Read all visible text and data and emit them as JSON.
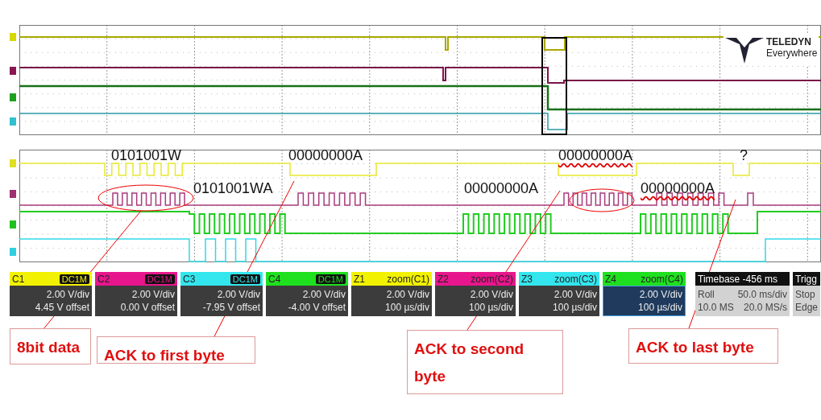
{
  "logo": {
    "brand": "TELEDYN",
    "tagline": "Everywhere"
  },
  "decode_labels": [
    {
      "text": "0101001W",
      "squiggle": false
    },
    {
      "text": "00000000A",
      "squiggle": false
    },
    {
      "text": "00000000A",
      "squiggle": true
    },
    {
      "text": "?",
      "squiggle": false
    },
    {
      "text": "0101001WA",
      "squiggle": false
    },
    {
      "text": "00000000A",
      "squiggle": false
    },
    {
      "text": "00000000A",
      "squiggle": true
    }
  ],
  "channels": [
    {
      "label": "C1",
      "coupling": "DC1M",
      "scale": "2.00 V/div",
      "offset": "4.45 V offset",
      "color": "#f2f200"
    },
    {
      "label": "C2",
      "coupling": "DC1M",
      "scale": "2.00 V/div",
      "offset": "0.00 V offset",
      "color": "#e8168c"
    },
    {
      "label": "C3",
      "coupling": "DC1M",
      "scale": "2.00 V/div",
      "offset": "-7.95 V offset",
      "color": "#33e6ee"
    },
    {
      "label": "C4",
      "coupling": "DC1M",
      "scale": "2.00 V/div",
      "offset": "-4.00 V offset",
      "color": "#1fe01f"
    }
  ],
  "zooms": [
    {
      "label": "Z1",
      "source": "zoom(C1)",
      "scale": "2.00 V/div",
      "time": "100 µs/div",
      "color": "#f2f200",
      "selected": false
    },
    {
      "label": "Z2",
      "source": "zoom(C2)",
      "scale": "2.00 V/div",
      "time": "100 µs/div",
      "color": "#e8168c",
      "selected": false
    },
    {
      "label": "Z3",
      "source": "zoom(C3)",
      "scale": "2.00 V/div",
      "time": "100 µs/div",
      "color": "#33e6ee",
      "selected": false
    },
    {
      "label": "Z4",
      "source": "zoom(C4)",
      "scale": "2.00 V/div",
      "time": "100 µs/div",
      "color": "#1fe01f",
      "selected": true
    }
  ],
  "timebase": {
    "title": "Timebase -456 ms",
    "mode": "Roll",
    "time": "50.0 ms/div",
    "samples": "10.0 MS",
    "rate": "20.0 MS/s"
  },
  "trigger": {
    "title": "Trigg",
    "state": "Stop",
    "type": "Edge"
  },
  "annotations": [
    {
      "text": "8bit data"
    },
    {
      "text": "ACK to first byte"
    },
    {
      "text": "ACK to second byte"
    },
    {
      "text": "ACK to last byte"
    }
  ]
}
